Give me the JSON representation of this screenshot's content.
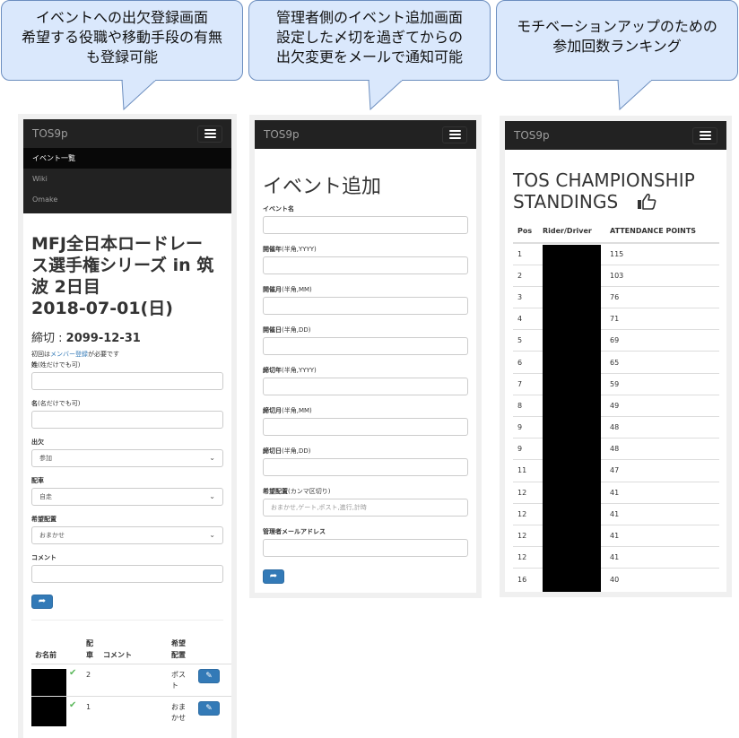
{
  "callouts": [
    {
      "lines": [
        "イベントへの出欠登録画面",
        "希望する役職や移動手段の有無",
        "も登録可能"
      ]
    },
    {
      "lines": [
        "管理者側のイベント追加画面",
        "設定した〆切を過ぎてからの",
        "出欠変更をメールで通知可能"
      ]
    },
    {
      "lines": [
        "モチベーションアップのための",
        "参加回数ランキング"
      ]
    }
  ],
  "app": {
    "brand": "TOS9p"
  },
  "screen1": {
    "menu": [
      "イベント一覧",
      "Wiki",
      "Omake"
    ],
    "title_lines": [
      "MFJ全日本ロードレー",
      "ス選手権シリーズ in 筑",
      "波 2日目",
      "2018-07-01(日)"
    ],
    "deadline_label": "締切 :",
    "deadline_value": "2099-12-31",
    "note_before": "初回は",
    "note_link": "メンバー登録",
    "note_after": "が必要です",
    "fields": {
      "last_name": {
        "label": "姓",
        "hint": "(姓だけでも可)"
      },
      "first_name": {
        "label": "名",
        "hint": "(名だけでも可)"
      },
      "attendance": {
        "label": "出欠",
        "value": "参加"
      },
      "car": {
        "label": "配車",
        "value": "自走"
      },
      "position": {
        "label": "希望配置",
        "value": "おまかせ"
      },
      "comment": {
        "label": "コメント"
      }
    },
    "submit_icon": "share-arrow-icon",
    "table": {
      "headers": {
        "name": "お名前",
        "car_1": "配",
        "car_2": "車",
        "comment": "コメント",
        "pos_1": "希望",
        "pos_2": "配置"
      },
      "rows": [
        {
          "car": "2",
          "pos_1": "ポス",
          "pos_2": "ト"
        },
        {
          "car": "1",
          "pos_1": "おま",
          "pos_2": "かせ"
        }
      ]
    }
  },
  "screen2": {
    "title": "イベント追加",
    "fields": [
      {
        "label": "イベント名",
        "hint": "",
        "placeholder": ""
      },
      {
        "label": "開催年",
        "hint": "(半角,YYYY)",
        "placeholder": ""
      },
      {
        "label": "開催月",
        "hint": "(半角,MM)",
        "placeholder": ""
      },
      {
        "label": "開催日",
        "hint": "(半角,DD)",
        "placeholder": ""
      },
      {
        "label": "締切年",
        "hint": "(半角,YYYY)",
        "placeholder": ""
      },
      {
        "label": "締切月",
        "hint": "(半角,MM)",
        "placeholder": ""
      },
      {
        "label": "締切日",
        "hint": "(半角,DD)",
        "placeholder": ""
      },
      {
        "label": "希望配置",
        "hint": "(カンマ区切り)",
        "placeholder": "おまかせ,ゲート,ポスト,進行,計時"
      },
      {
        "label": "管理者メールアドレス",
        "hint": "",
        "placeholder": ""
      }
    ]
  },
  "screen3": {
    "title_lines": [
      "TOS CHAMPIONSHIP",
      "STANDINGS"
    ],
    "title_icon": "thumbs-up-icon",
    "headers": [
      "Pos",
      "Rider/Driver",
      "ATTENDANCE POINTS"
    ],
    "rows": [
      {
        "pos": "1",
        "points": "115"
      },
      {
        "pos": "2",
        "points": "103"
      },
      {
        "pos": "3",
        "points": "76"
      },
      {
        "pos": "4",
        "points": "71"
      },
      {
        "pos": "5",
        "points": "69"
      },
      {
        "pos": "6",
        "points": "65"
      },
      {
        "pos": "7",
        "points": "59"
      },
      {
        "pos": "8",
        "points": "49"
      },
      {
        "pos": "9",
        "points": "48"
      },
      {
        "pos": "9",
        "points": "48"
      },
      {
        "pos": "11",
        "points": "47"
      },
      {
        "pos": "12",
        "points": "41"
      },
      {
        "pos": "12",
        "points": "41"
      },
      {
        "pos": "12",
        "points": "41"
      },
      {
        "pos": "12",
        "points": "41"
      },
      {
        "pos": "16",
        "points": "40"
      }
    ]
  },
  "colors": {
    "bubble_fill": "#dae8fc",
    "bubble_border": "#6c8ebf",
    "navbar": "#222222",
    "primary": "#337ab7",
    "check": "#5cb85c"
  }
}
